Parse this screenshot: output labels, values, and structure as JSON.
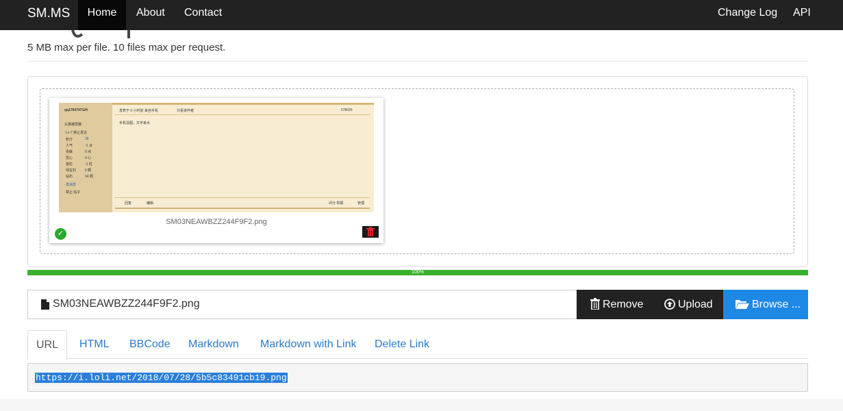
{
  "navbar": {
    "brand": "SM.MS",
    "links": [
      {
        "label": "Home",
        "active": true
      },
      {
        "label": "About",
        "active": false
      },
      {
        "label": "Contact",
        "active": false
      }
    ],
    "right_links": [
      {
        "label": "Change Log"
      },
      {
        "label": "API"
      }
    ]
  },
  "page": {
    "subtitle": "5 MB max per file. 10 files max per request."
  },
  "preview": {
    "filename": "SM03NEAWBZZ244F9F2.png",
    "status_icon": "check-circle-icon",
    "thumbnail": {
      "username": "qq1760747124",
      "side_title": "头像被屏蔽",
      "side_rank": "Lv-7 禁止发言",
      "stats": [
        {
          "k": "积分",
          "v": "38"
        },
        {
          "k": "人气",
          "v": "-1 点"
        },
        {
          "k": "贡献",
          "v": "0 点"
        },
        {
          "k": "爱心",
          "v": "0 心"
        },
        {
          "k": "金粒",
          "v": "-1 粒"
        },
        {
          "k": "绿宝石",
          "v": "0 颗"
        },
        {
          "k": "钻石",
          "v": "14 颗"
        }
      ],
      "send_msg": "发消息",
      "ban": "禁止 帖子",
      "post_meta": "发表于 6 小时前 来自手机",
      "only_author": "只看该作者",
      "post_id": "578025",
      "body": "手机没图，文字来水",
      "reply": "回复",
      "edit": "编辑",
      "actions": "评分  举报",
      "manage": "管理"
    }
  },
  "progress": {
    "percent": 100,
    "label": "100%"
  },
  "file_input": {
    "filename": "SM03NEAWBZZ244F9F2.png",
    "remove_label": "Remove",
    "upload_label": "Upload",
    "browse_label": "Browse ..."
  },
  "tabs": [
    {
      "label": "URL",
      "active": true
    },
    {
      "label": "HTML",
      "active": false
    },
    {
      "label": "BBCode",
      "active": false
    },
    {
      "label": "Markdown",
      "active": false
    },
    {
      "label": "Markdown with Link",
      "active": false
    },
    {
      "label": "Delete Link",
      "active": false
    }
  ],
  "result": {
    "url": "https://i.loli.net/2018/07/28/5b5c83491cb19.png"
  },
  "colors": {
    "navbar": "#222222",
    "progress": "#39b12c",
    "browse": "#1e88e5",
    "link": "#2a7cc7"
  }
}
